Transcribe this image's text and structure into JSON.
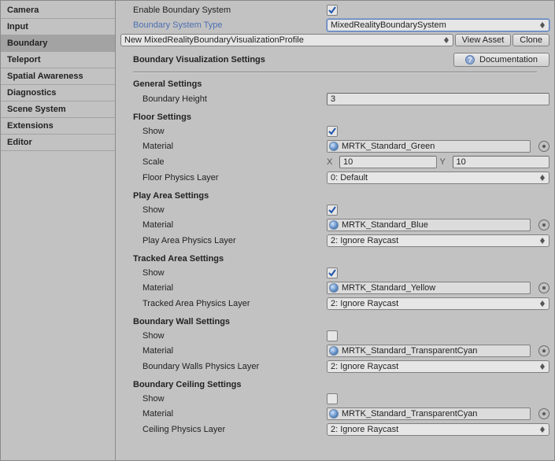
{
  "sidebar": {
    "items": [
      {
        "label": "Camera"
      },
      {
        "label": "Input"
      },
      {
        "label": "Boundary",
        "selected": true
      },
      {
        "label": "Teleport"
      },
      {
        "label": "Spatial Awareness"
      },
      {
        "label": "Diagnostics"
      },
      {
        "label": "Scene System"
      },
      {
        "label": "Extensions"
      },
      {
        "label": "Editor"
      }
    ]
  },
  "main": {
    "enableLabel": "Enable Boundary System",
    "enableChecked": true,
    "typeLabel": "Boundary System Type",
    "typeValue": "MixedRealityBoundarySystem",
    "profileValue": "New MixedRealityBoundaryVisualizationProfile",
    "viewAssetLabel": "View Asset",
    "cloneLabel": "Clone",
    "visualizationTitle": "Boundary Visualization Settings",
    "documentationLabel": "Documentation",
    "general": {
      "title": "General Settings",
      "boundaryHeightLabel": "Boundary Height",
      "boundaryHeightValue": "3"
    },
    "floor": {
      "title": "Floor Settings",
      "showLabel": "Show",
      "showChecked": true,
      "materialLabel": "Material",
      "materialValue": "MRTK_Standard_Green",
      "scaleLabel": "Scale",
      "scaleX": "10",
      "scaleY": "10",
      "physicsLayerLabel": "Floor Physics Layer",
      "physicsLayerValue": "0: Default"
    },
    "playArea": {
      "title": "Play Area Settings",
      "showLabel": "Show",
      "showChecked": true,
      "materialLabel": "Material",
      "materialValue": "MRTK_Standard_Blue",
      "physicsLayerLabel": "Play Area Physics Layer",
      "physicsLayerValue": "2: Ignore Raycast"
    },
    "trackedArea": {
      "title": "Tracked Area Settings",
      "showLabel": "Show",
      "showChecked": true,
      "materialLabel": "Material",
      "materialValue": "MRTK_Standard_Yellow",
      "physicsLayerLabel": "Tracked Area Physics Layer",
      "physicsLayerValue": "2: Ignore Raycast"
    },
    "wall": {
      "title": "Boundary Wall Settings",
      "showLabel": "Show",
      "showChecked": false,
      "materialLabel": "Material",
      "materialValue": "MRTK_Standard_TransparentCyan",
      "physicsLayerLabel": "Boundary Walls Physics Layer",
      "physicsLayerValue": "2: Ignore Raycast"
    },
    "ceiling": {
      "title": "Boundary Ceiling Settings",
      "showLabel": "Show",
      "showChecked": false,
      "materialLabel": "Material",
      "materialValue": "MRTK_Standard_TransparentCyan",
      "physicsLayerLabel": "Ceiling Physics Layer",
      "physicsLayerValue": "2: Ignore Raycast"
    },
    "xLabel": "X",
    "yLabel": "Y"
  }
}
